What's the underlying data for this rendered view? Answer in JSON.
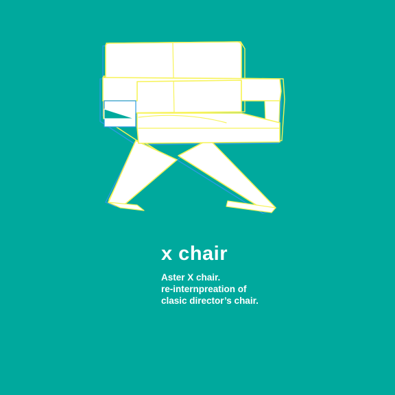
{
  "product": {
    "title": "x chair",
    "description_lines": [
      "Aster X chair.",
      "re-internpreation of",
      "clasic director’s chair."
    ]
  },
  "colors": {
    "background": "#00a99d",
    "chair_fill": "#ffffff",
    "outline_yellow": "#f7f35a",
    "outline_blue": "#2b9be0",
    "text": "#ffffff"
  },
  "illustration": {
    "icon": "director-chair-icon"
  }
}
